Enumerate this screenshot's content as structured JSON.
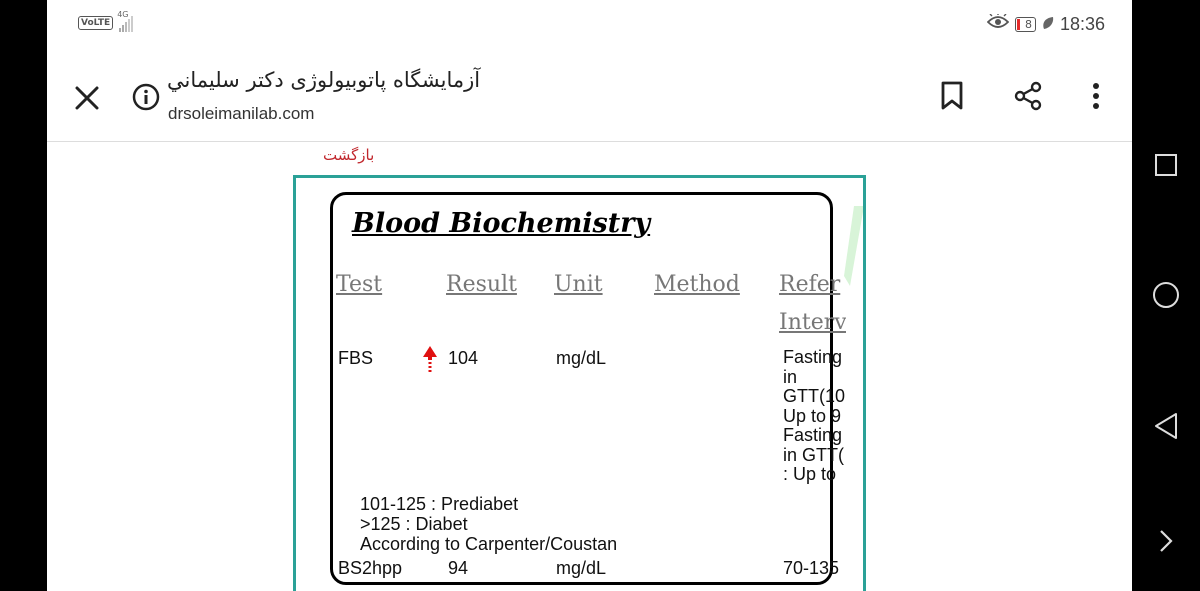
{
  "status_bar": {
    "network_label": "VoLTE",
    "network_type": "4G",
    "battery_level": "8",
    "time": "18:36"
  },
  "toolbar": {
    "site_title": "آزمايشگاه پاتوبيولوژی دکتر سليماني",
    "site_url": "drsoleimanilab.com"
  },
  "page": {
    "back_link": "بازگشت",
    "title": "Blood Biochemistry",
    "columns": [
      "Test",
      "Result",
      "Unit",
      "Method",
      "Refer",
      "Interv"
    ],
    "rows": [
      {
        "test": "FBS",
        "flag": "high-arrow-icon",
        "result": "104",
        "unit": "mg/dL",
        "method": "",
        "reference": [
          "Fasting",
          "in",
          "GTT(10",
          "Up to 9",
          "Fasting",
          "in GTT(",
          ": Up to"
        ]
      },
      {
        "test": "BS2hpp",
        "flag": "",
        "result": "94",
        "unit": "mg/dL",
        "method": "",
        "reference": [
          "70-135"
        ]
      }
    ],
    "notes": [
      "101-125 : Prediabet",
      ">125 : Diabet",
      "According to Carpenter/Coustan"
    ]
  },
  "colors": {
    "frame_border": "#2aa197",
    "back_link": "#c1272d",
    "high_flag": "#e01010"
  }
}
